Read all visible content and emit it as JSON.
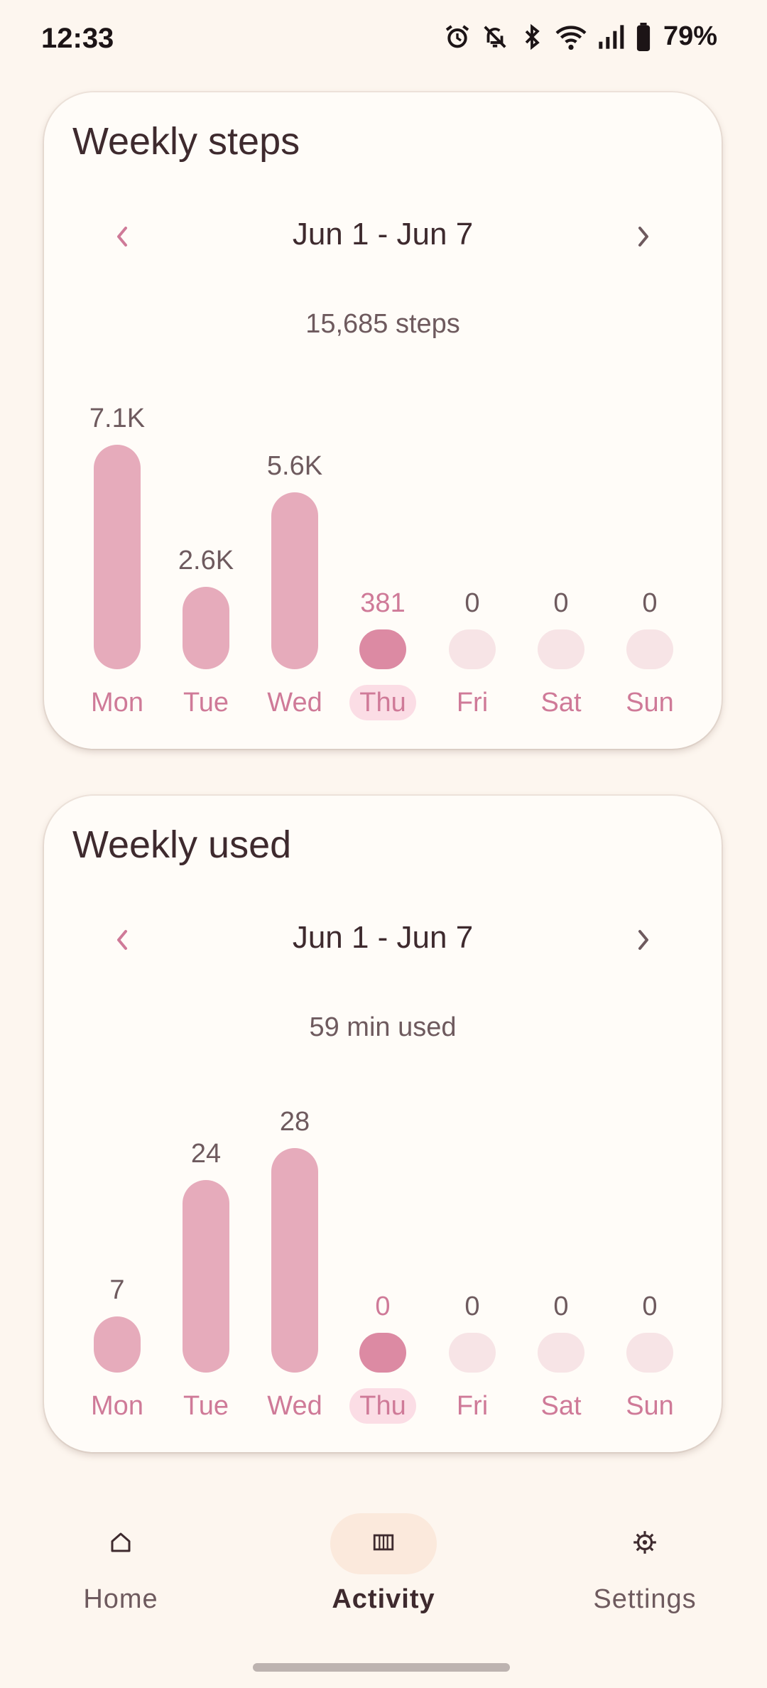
{
  "status_bar": {
    "time": "12:33",
    "battery": "79%",
    "icons": [
      "alarm-icon",
      "bell-off-icon",
      "bluetooth-icon",
      "wifi-icon",
      "signal-icon",
      "battery-icon"
    ]
  },
  "steps_card": {
    "title": "Weekly steps",
    "range": "Jun 1 - Jun 7",
    "total": "15,685 steps",
    "prev_icon": "chevron-left-icon",
    "next_icon": "chevron-right-icon"
  },
  "used_card": {
    "title": "Weekly used",
    "range": "Jun 1 - Jun 7",
    "total": "59 min used",
    "prev_icon": "chevron-left-icon",
    "next_icon": "chevron-right-icon"
  },
  "chart_data": [
    {
      "type": "bar",
      "title": "Weekly steps",
      "categories": [
        "Mon",
        "Tue",
        "Wed",
        "Thu",
        "Fri",
        "Sat",
        "Sun"
      ],
      "values": [
        7100,
        2600,
        5600,
        381,
        0,
        0,
        0
      ],
      "value_labels": [
        "7.1K",
        "2.6K",
        "5.6K",
        "381",
        "0",
        "0",
        "0"
      ],
      "highlight": "Thu",
      "ylim": [
        0,
        7100
      ],
      "grid": false
    },
    {
      "type": "bar",
      "title": "Weekly used",
      "categories": [
        "Mon",
        "Tue",
        "Wed",
        "Thu",
        "Fri",
        "Sat",
        "Sun"
      ],
      "values": [
        7,
        24,
        28,
        0,
        0,
        0,
        0
      ],
      "value_labels": [
        "7",
        "24",
        "28",
        "0",
        "0",
        "0",
        "0"
      ],
      "highlight": "Thu",
      "ylim": [
        0,
        28
      ],
      "grid": false
    }
  ],
  "colors": {
    "bar": "#e6abbb",
    "bar_today": "#dc8aa3",
    "bar_empty": "#f7e4e6",
    "accent": "#cf7a98",
    "background": "#fdf6ef",
    "card": "#fffcf8"
  },
  "bottom_nav": {
    "items": [
      {
        "label": "Home",
        "icon": "home-icon"
      },
      {
        "label": "Activity",
        "icon": "activity-icon"
      },
      {
        "label": "Settings",
        "icon": "gear-icon"
      }
    ],
    "active": "Activity"
  }
}
